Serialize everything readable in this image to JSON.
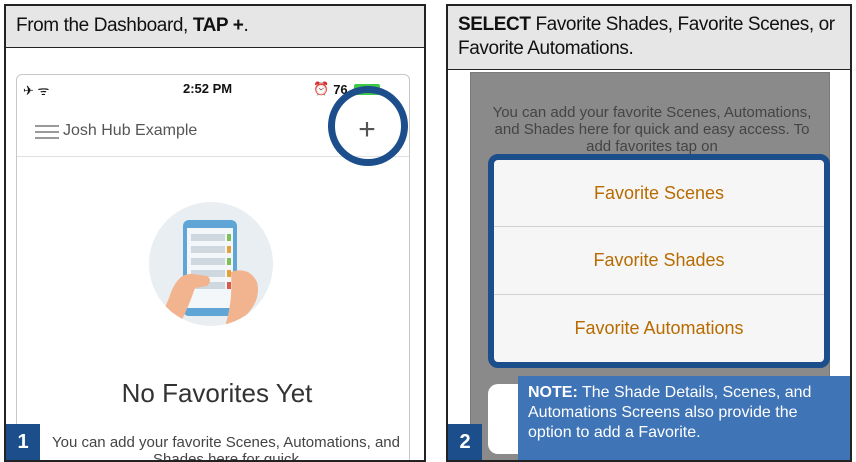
{
  "step1": {
    "header_prefix": "From the Dashboard, ",
    "header_action": "TAP +",
    "header_suffix": ".",
    "step_number": "1",
    "status": {
      "time": "2:52 PM",
      "battery_text": "76"
    },
    "hub_title": "Josh Hub Example",
    "plus_label": "+",
    "empty_title": "No Favorites Yet",
    "empty_desc": "You can add your favorite Scenes, Automations, and Shades here for quick"
  },
  "step2": {
    "header_action": "SELECT",
    "header_rest": " Favorite Shades, Favorite Scenes, or Favorite Automations.",
    "step_number": "2",
    "bg_text": "You can add your favorite Scenes, Automations, and Shades here for quick and easy access. To add favorites tap on",
    "menu_items": [
      "Favorite Scenes",
      "Favorite Shades",
      "Favorite Automations"
    ],
    "note_label": "NOTE:",
    "note_text": " The Shade Details, Scenes, and Automations Screens also provide the option to add a Favorite."
  },
  "colors": {
    "accent_blue": "#1d4e8c",
    "note_blue": "#3f74b6",
    "menu_text_orange": "#b86b00",
    "battery_green": "#3ec84a"
  }
}
